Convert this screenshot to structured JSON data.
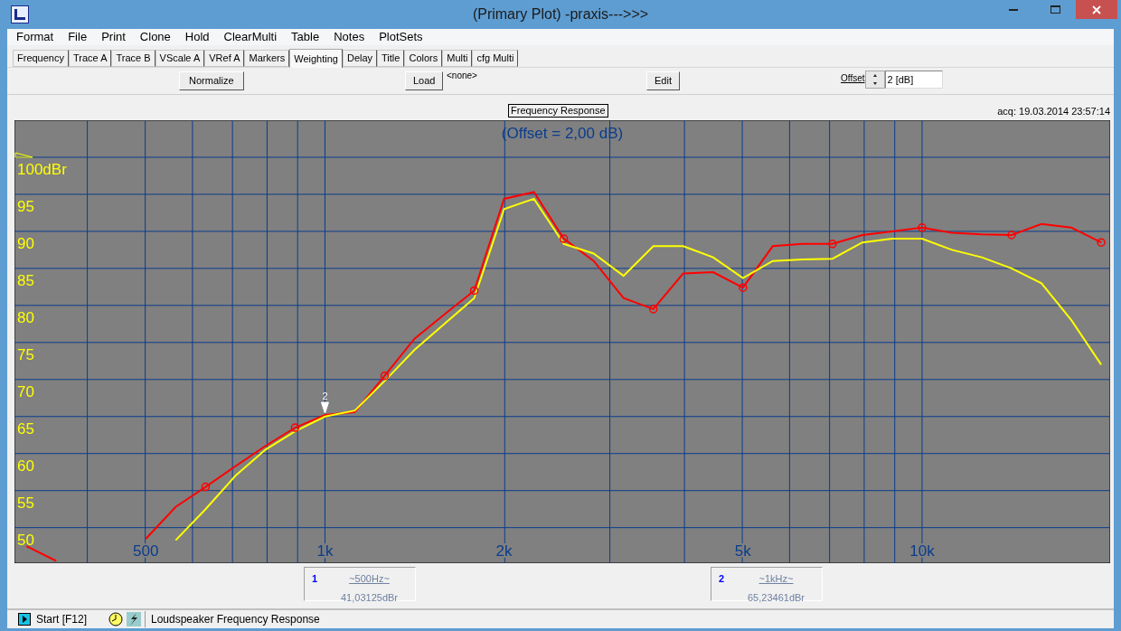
{
  "window": {
    "title": "(Primary Plot) -praxis--->>>"
  },
  "menu": [
    "Format",
    "File",
    "Print",
    "Clone",
    "Hold",
    "ClearMulti",
    "Table",
    "Notes",
    "PlotSets"
  ],
  "tabs": [
    {
      "label": "Frequency",
      "selected": false
    },
    {
      "label": "Trace A",
      "selected": false
    },
    {
      "label": "Trace B",
      "selected": false
    },
    {
      "label": "VScale A",
      "selected": false
    },
    {
      "label": "VRef A",
      "selected": false
    },
    {
      "label": "Markers",
      "selected": false
    },
    {
      "label": "Weighting",
      "selected": true
    },
    {
      "label": "Delay",
      "selected": false
    },
    {
      "label": "Title",
      "selected": false
    },
    {
      "label": "Colors",
      "selected": false
    },
    {
      "label": "Multi",
      "selected": false
    },
    {
      "label": "cfg Multi",
      "selected": false
    }
  ],
  "toolbar": {
    "normalize": "Normalize",
    "load": "Load",
    "weighting_file": "<none>",
    "edit": "Edit",
    "offset_label": "Offset",
    "offset_value": "2 [dB]"
  },
  "plot": {
    "title": "Frequency Response",
    "acquired": "acq: 19.03.2014 23:57:14",
    "subtitle": "(Offset = 2,00 dB)",
    "marker_label": "2",
    "chart_data": {
      "type": "line",
      "grid": true,
      "ylim": [
        45.2,
        105
      ],
      "categories": [
        null,
        null,
        null,
        null,
        "500",
        null,
        null,
        null,
        null,
        null,
        "1k",
        null,
        null,
        null,
        null,
        null,
        "2k",
        null,
        null,
        null,
        null,
        null,
        null,
        null,
        "5k",
        null,
        null,
        null,
        null,
        null,
        "10k",
        null,
        null,
        null,
        null,
        null,
        null
      ],
      "yticks": [
        {
          "value": 100,
          "label": "100dBr"
        },
        {
          "value": 95,
          "label": "95"
        },
        {
          "value": 90,
          "label": "90"
        },
        {
          "value": 85,
          "label": "85"
        },
        {
          "value": 80,
          "label": "80"
        },
        {
          "value": 75,
          "label": "75"
        },
        {
          "value": 70,
          "label": "70"
        },
        {
          "value": 65,
          "label": "65"
        },
        {
          "value": 60,
          "label": "60"
        },
        {
          "value": 55,
          "label": "55"
        },
        {
          "value": 50,
          "label": "50"
        }
      ],
      "series": [
        {
          "color": "#ff0000",
          "values": [
            47.5,
            45.5,
            null,
            null,
            48.5,
            52.8,
            55.5,
            58.3,
            61,
            63.5,
            65.2,
            65.6,
            70.5,
            75.5,
            78.8,
            82,
            94.4,
            95.3,
            89,
            86,
            81,
            79.5,
            84.3,
            84.5,
            82.4,
            88,
            88.3,
            88.3,
            89.5,
            90,
            90.5,
            89.8,
            89.6,
            89.5,
            91,
            90.5,
            88.5
          ]
        },
        {
          "color": "#ffff00",
          "values": [
            null,
            null,
            null,
            null,
            null,
            48.3,
            52.5,
            57,
            60.5,
            63,
            65,
            65.8,
            69.8,
            74,
            77.5,
            81,
            93,
            94.4,
            88.3,
            87,
            84,
            88,
            88,
            86.5,
            83.7,
            86,
            86.2,
            86.3,
            88.5,
            89,
            89,
            87.5,
            86.5,
            85,
            83,
            78,
            72
          ]
        }
      ]
    }
  },
  "readouts": [
    {
      "number": "1",
      "frequency": "~500Hz~",
      "value": "41,03125dBr"
    },
    {
      "number": "2",
      "frequency": "~1kHz~",
      "value": "65,23461dBr"
    }
  ],
  "status_bar": {
    "start": "Start [F12]",
    "description": "Loudspeaker Frequency Response"
  }
}
